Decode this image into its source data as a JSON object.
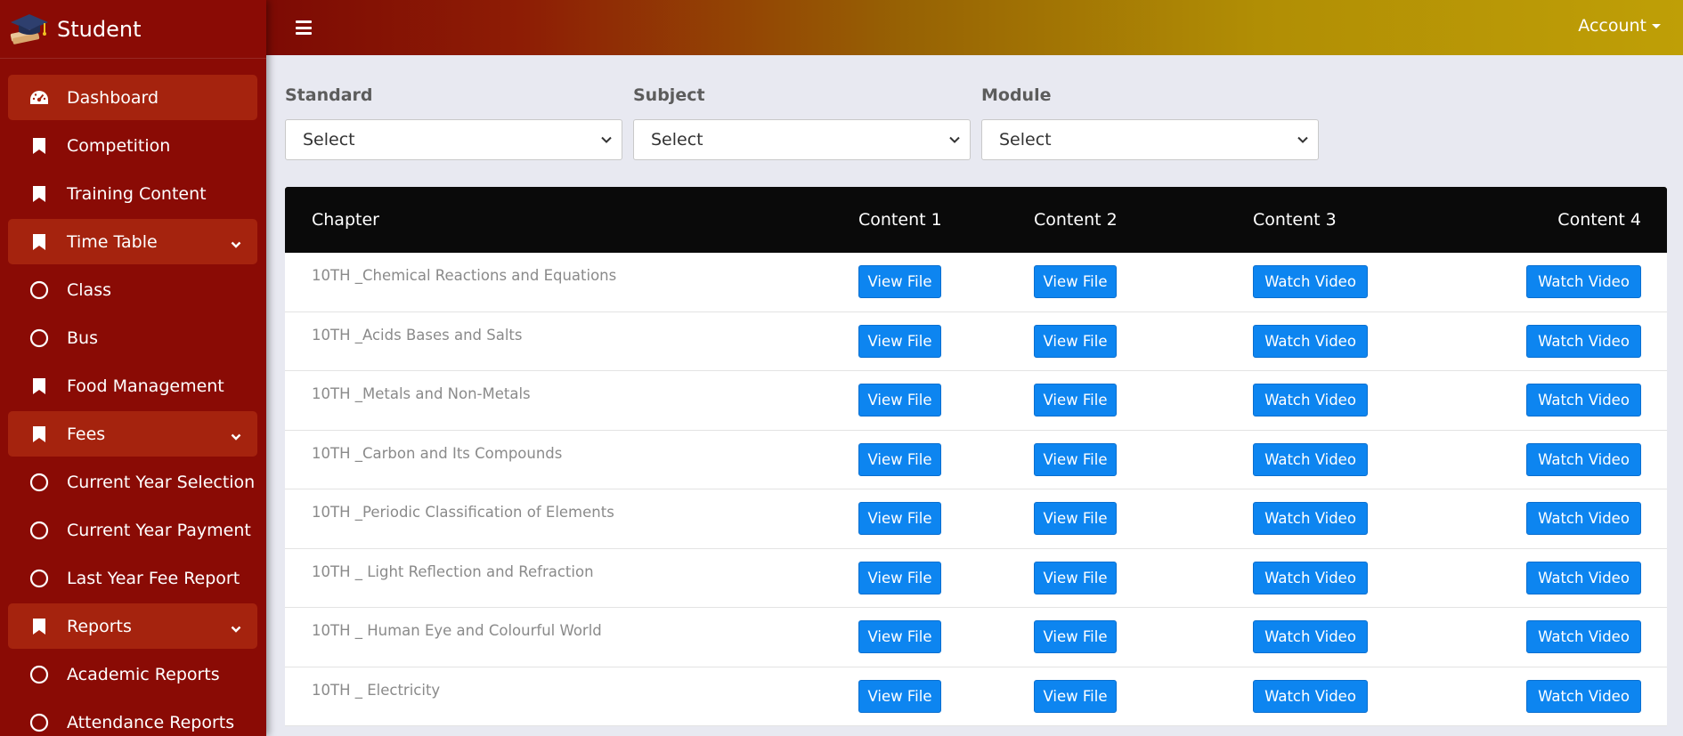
{
  "sidebar": {
    "brand": "Student",
    "items": [
      {
        "label": "Dashboard",
        "icon": "dashboard-icon",
        "boxed": true,
        "chevron": false
      },
      {
        "label": "Competition",
        "icon": "bookmark-icon",
        "boxed": false,
        "chevron": false
      },
      {
        "label": "Training Content",
        "icon": "bookmark-icon",
        "boxed": false,
        "chevron": false
      },
      {
        "label": "Time Table",
        "icon": "bookmark-icon",
        "boxed": true,
        "chevron": true
      },
      {
        "label": "Class",
        "icon": "circle-icon",
        "boxed": false,
        "chevron": false
      },
      {
        "label": "Bus",
        "icon": "circle-icon",
        "boxed": false,
        "chevron": false
      },
      {
        "label": "Food Management",
        "icon": "bookmark-icon",
        "boxed": false,
        "chevron": false
      },
      {
        "label": "Fees",
        "icon": "bookmark-icon",
        "boxed": true,
        "chevron": true
      },
      {
        "label": "Current Year Selection",
        "icon": "circle-icon",
        "boxed": false,
        "chevron": false
      },
      {
        "label": "Current Year Payment",
        "icon": "circle-icon",
        "boxed": false,
        "chevron": false
      },
      {
        "label": "Last Year Fee Report",
        "icon": "circle-icon",
        "boxed": false,
        "chevron": false
      },
      {
        "label": "Reports",
        "icon": "bookmark-icon",
        "boxed": true,
        "chevron": true
      },
      {
        "label": "Academic Reports",
        "icon": "circle-icon",
        "boxed": false,
        "chevron": false
      },
      {
        "label": "Attendance Reports",
        "icon": "circle-icon",
        "boxed": false,
        "chevron": false
      }
    ]
  },
  "topbar": {
    "account_label": "Account"
  },
  "filters": [
    {
      "label": "Standard",
      "value": "Select"
    },
    {
      "label": "Subject",
      "value": "Select"
    },
    {
      "label": "Module",
      "value": "Select"
    }
  ],
  "table": {
    "headers": [
      "Chapter",
      "Content 1",
      "Content 2",
      "Content 3",
      "Content 4"
    ],
    "rows": [
      {
        "chapter": "10TH _Chemical Reactions and Equations",
        "c1": "View File",
        "c2": "View File",
        "c3": "Watch Video",
        "c4": "Watch Video"
      },
      {
        "chapter": "10TH _Acids Bases and Salts",
        "c1": "View File",
        "c2": "View File",
        "c3": "Watch Video",
        "c4": "Watch Video"
      },
      {
        "chapter": "10TH _Metals and Non-Metals",
        "c1": "View File",
        "c2": "View File",
        "c3": "Watch Video",
        "c4": "Watch Video"
      },
      {
        "chapter": "10TH _Carbon and Its Compounds",
        "c1": "View File",
        "c2": "View File",
        "c3": "Watch Video",
        "c4": "Watch Video"
      },
      {
        "chapter": "10TH _Periodic Classification of Elements",
        "c1": "View File",
        "c2": "View File",
        "c3": "Watch Video",
        "c4": "Watch Video"
      },
      {
        "chapter": "10TH _ Light Reflection and Refraction",
        "c1": "View File",
        "c2": "View File",
        "c3": "Watch Video",
        "c4": "Watch Video"
      },
      {
        "chapter": "10TH _ Human Eye and Colourful World",
        "c1": "View File",
        "c2": "View File",
        "c3": "Watch Video",
        "c4": "Watch Video"
      },
      {
        "chapter": "10TH _ Electricity",
        "c1": "View File",
        "c2": "View File",
        "c3": "Watch Video",
        "c4": "Watch Video"
      }
    ]
  },
  "colors": {
    "sidebar_bg": "#8a0b05",
    "sidebar_boxed": "#a5230e",
    "button_blue": "#0d85f0",
    "table_header": "#0a0a0a"
  }
}
